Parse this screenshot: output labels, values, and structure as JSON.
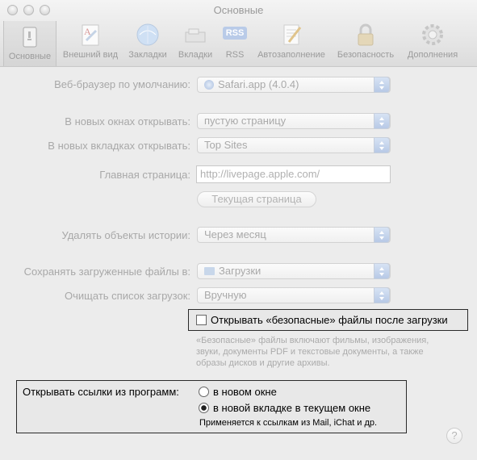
{
  "window": {
    "title": "Основные"
  },
  "toolbar": {
    "items": [
      {
        "label": "Основные",
        "icon": "general-icon"
      },
      {
        "label": "Внешний вид",
        "icon": "appearance-icon"
      },
      {
        "label": "Закладки",
        "icon": "bookmarks-icon"
      },
      {
        "label": "Вкладки",
        "icon": "tabs-icon"
      },
      {
        "label": "RSS",
        "icon": "rss-icon"
      },
      {
        "label": "Автозаполнение",
        "icon": "autofill-icon"
      },
      {
        "label": "Безопасность",
        "icon": "security-icon"
      },
      {
        "label": "Дополнения",
        "icon": "advanced-icon"
      }
    ],
    "rss_badge": "RSS"
  },
  "form": {
    "default_browser_label": "Веб-браузер по умолчанию:",
    "default_browser_value": "Safari.app (4.0.4)",
    "new_windows_label": "В новых окнах открывать:",
    "new_windows_value": "пустую страницу",
    "new_tabs_label": "В новых вкладках открывать:",
    "new_tabs_value": "Top Sites",
    "homepage_label": "Главная страница:",
    "homepage_value": "http://livepage.apple.com/",
    "current_page_button": "Текущая страница",
    "remove_history_label": "Удалять объекты истории:",
    "remove_history_value": "Через месяц",
    "save_downloads_label": "Сохранять загруженные файлы в:",
    "save_downloads_value": "Загрузки",
    "clear_downloads_label": "Очищать список загрузок:",
    "clear_downloads_value": "Вручную",
    "open_safe_files_label": "Открывать «безопасные» файлы после загрузки",
    "open_safe_files_checked": false,
    "safe_files_note_1": "«Безопасные» файлы включают фильмы, изображения,",
    "safe_files_note_2": "звуки, документы PDF и текстовые документы, а также",
    "safe_files_note_3": "образы дисков и другие архивы.",
    "open_links_label": "Открывать ссылки из программ:",
    "open_links_option_1": "в новом окне",
    "open_links_option_2": "в новой вкладке в текущем окне",
    "open_links_selected": 2,
    "open_links_note": "Применяется к ссылкам из Mail, iChat и др."
  },
  "help": {
    "label": "?"
  }
}
